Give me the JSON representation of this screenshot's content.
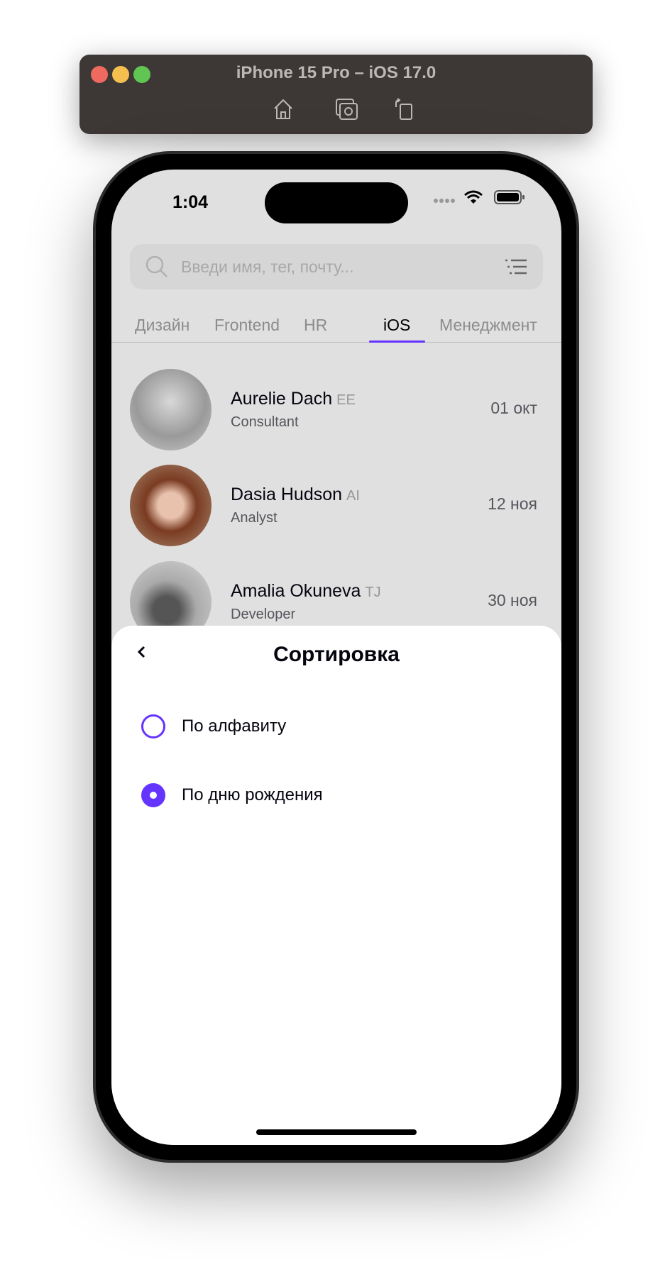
{
  "window": {
    "title": "iPhone 15 Pro – iOS 17.0",
    "icons": [
      "home-icon",
      "screenshot-icon",
      "rotate-icon"
    ]
  },
  "status": {
    "time": "1:04"
  },
  "search": {
    "placeholder": "Введи имя, тег, почту..."
  },
  "tabs": [
    {
      "label": "Дизайн"
    },
    {
      "label": "Frontend"
    },
    {
      "label": "HR"
    },
    {
      "label": "iOS",
      "active": true
    },
    {
      "label": "Менеджмент"
    }
  ],
  "people": [
    {
      "name": "Aurelie Dach",
      "tag": "EE",
      "position": "Consultant",
      "date": "01 окт"
    },
    {
      "name": "Dasia Hudson",
      "tag": "AI",
      "position": "Analyst",
      "date": "12 ноя"
    },
    {
      "name": "Amalia Okuneva",
      "tag": "TJ",
      "position": "Developer",
      "date": "30 ноя"
    }
  ],
  "sheet": {
    "title": "Сортировка",
    "options": [
      {
        "label": "По алфавиту",
        "selected": false
      },
      {
        "label": "По дню рождения",
        "selected": true
      }
    ]
  },
  "colors": {
    "accent": "#6534ff"
  }
}
